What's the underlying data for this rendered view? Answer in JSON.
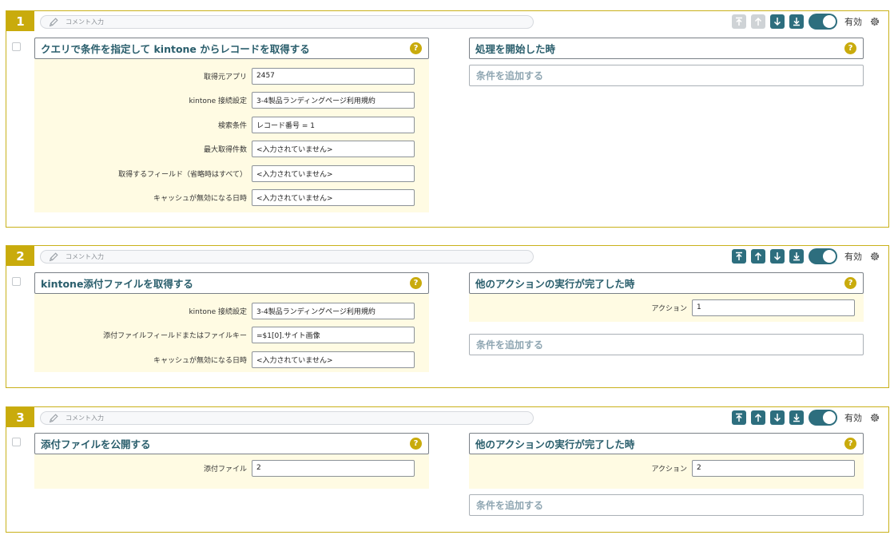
{
  "icons": {
    "pencil": "pencil-icon",
    "move_top": "arrow-to-top-icon",
    "move_up": "arrow-up-icon",
    "move_down": "arrow-down-icon",
    "move_bottom": "arrow-to-bottom-icon",
    "help": "question-icon",
    "settings": "gear-icon"
  },
  "colors": {
    "accent": "#c9ab0c",
    "primary": "#2d6e7e",
    "title_text": "#2a5e6c",
    "field_bg": "#fffbe3",
    "border": "#c9b11a"
  },
  "comment_placeholder": "コメント入力",
  "enabled_label": "有効",
  "help_mark": "?",
  "add_condition_label": "条件を追加する",
  "blocks": [
    {
      "number": "1",
      "comment": "",
      "move_up_enabled": false,
      "enabled": true,
      "action": {
        "title": "クエリで条件を指定して kintone からレコードを取得する",
        "fields": [
          {
            "label": "取得元アプリ",
            "value": "2457"
          },
          {
            "label": "kintone 接続設定",
            "value": "3-4製品ランディングページ利用規約"
          },
          {
            "label": "検索条件",
            "value": "レコード番号 = 1"
          },
          {
            "label": "最大取得件数",
            "value": "<入力されていません>"
          },
          {
            "label": "取得するフィールド（省略時はすべて）",
            "value": "<入力されていません>"
          },
          {
            "label": "キャッシュが無効になる日時",
            "value": "<入力されていません>"
          }
        ]
      },
      "trigger": {
        "title": "処理を開始した時",
        "fields": []
      }
    },
    {
      "number": "2",
      "comment": "",
      "move_up_enabled": true,
      "enabled": true,
      "action": {
        "title": "kintone添付ファイルを取得する",
        "fields": [
          {
            "label": "kintone 接続設定",
            "value": "3-4製品ランディングページ利用規約"
          },
          {
            "label": "添付ファイルフィールドまたはファイルキー",
            "value": "=$1[0].サイト画像"
          },
          {
            "label": "キャッシュが無効になる日時",
            "value": "<入力されていません>"
          }
        ]
      },
      "trigger": {
        "title": "他のアクションの実行が完了した時",
        "fields": [
          {
            "label": "アクション",
            "value": "1"
          }
        ]
      }
    },
    {
      "number": "3",
      "comment": "",
      "move_up_enabled": true,
      "enabled": true,
      "action": {
        "title": "添付ファイルを公開する",
        "fields": [
          {
            "label": "添付ファイル",
            "value": "2"
          }
        ]
      },
      "trigger": {
        "title": "他のアクションの実行が完了した時",
        "fields": [
          {
            "label": "アクション",
            "value": "2"
          }
        ]
      }
    }
  ]
}
